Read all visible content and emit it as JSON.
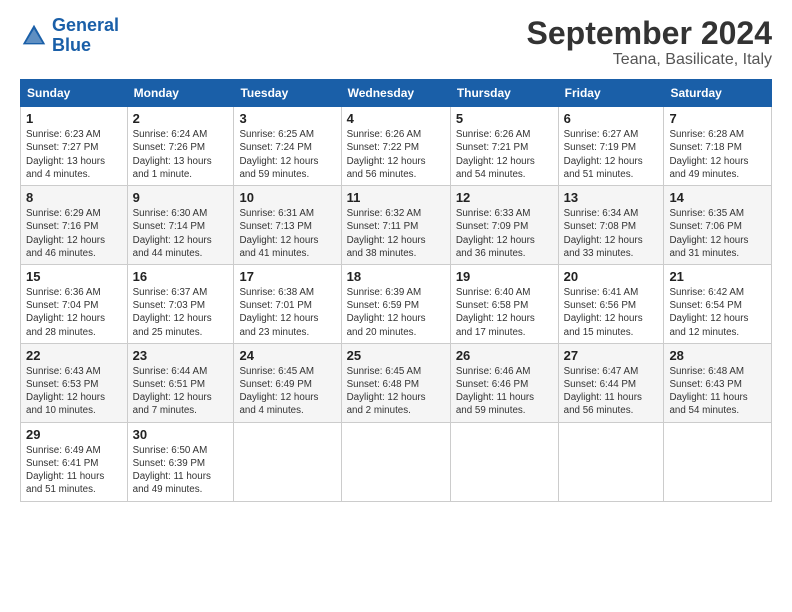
{
  "header": {
    "logo_line1": "General",
    "logo_line2": "Blue",
    "title": "September 2024",
    "subtitle": "Teana, Basilicate, Italy"
  },
  "days_of_week": [
    "Sunday",
    "Monday",
    "Tuesday",
    "Wednesday",
    "Thursday",
    "Friday",
    "Saturday"
  ],
  "weeks": [
    [
      {
        "num": "1",
        "text": "Sunrise: 6:23 AM\nSunset: 7:27 PM\nDaylight: 13 hours\nand 4 minutes."
      },
      {
        "num": "2",
        "text": "Sunrise: 6:24 AM\nSunset: 7:26 PM\nDaylight: 13 hours\nand 1 minute."
      },
      {
        "num": "3",
        "text": "Sunrise: 6:25 AM\nSunset: 7:24 PM\nDaylight: 12 hours\nand 59 minutes."
      },
      {
        "num": "4",
        "text": "Sunrise: 6:26 AM\nSunset: 7:22 PM\nDaylight: 12 hours\nand 56 minutes."
      },
      {
        "num": "5",
        "text": "Sunrise: 6:26 AM\nSunset: 7:21 PM\nDaylight: 12 hours\nand 54 minutes."
      },
      {
        "num": "6",
        "text": "Sunrise: 6:27 AM\nSunset: 7:19 PM\nDaylight: 12 hours\nand 51 minutes."
      },
      {
        "num": "7",
        "text": "Sunrise: 6:28 AM\nSunset: 7:18 PM\nDaylight: 12 hours\nand 49 minutes."
      }
    ],
    [
      {
        "num": "8",
        "text": "Sunrise: 6:29 AM\nSunset: 7:16 PM\nDaylight: 12 hours\nand 46 minutes."
      },
      {
        "num": "9",
        "text": "Sunrise: 6:30 AM\nSunset: 7:14 PM\nDaylight: 12 hours\nand 44 minutes."
      },
      {
        "num": "10",
        "text": "Sunrise: 6:31 AM\nSunset: 7:13 PM\nDaylight: 12 hours\nand 41 minutes."
      },
      {
        "num": "11",
        "text": "Sunrise: 6:32 AM\nSunset: 7:11 PM\nDaylight: 12 hours\nand 38 minutes."
      },
      {
        "num": "12",
        "text": "Sunrise: 6:33 AM\nSunset: 7:09 PM\nDaylight: 12 hours\nand 36 minutes."
      },
      {
        "num": "13",
        "text": "Sunrise: 6:34 AM\nSunset: 7:08 PM\nDaylight: 12 hours\nand 33 minutes."
      },
      {
        "num": "14",
        "text": "Sunrise: 6:35 AM\nSunset: 7:06 PM\nDaylight: 12 hours\nand 31 minutes."
      }
    ],
    [
      {
        "num": "15",
        "text": "Sunrise: 6:36 AM\nSunset: 7:04 PM\nDaylight: 12 hours\nand 28 minutes."
      },
      {
        "num": "16",
        "text": "Sunrise: 6:37 AM\nSunset: 7:03 PM\nDaylight: 12 hours\nand 25 minutes."
      },
      {
        "num": "17",
        "text": "Sunrise: 6:38 AM\nSunset: 7:01 PM\nDaylight: 12 hours\nand 23 minutes."
      },
      {
        "num": "18",
        "text": "Sunrise: 6:39 AM\nSunset: 6:59 PM\nDaylight: 12 hours\nand 20 minutes."
      },
      {
        "num": "19",
        "text": "Sunrise: 6:40 AM\nSunset: 6:58 PM\nDaylight: 12 hours\nand 17 minutes."
      },
      {
        "num": "20",
        "text": "Sunrise: 6:41 AM\nSunset: 6:56 PM\nDaylight: 12 hours\nand 15 minutes."
      },
      {
        "num": "21",
        "text": "Sunrise: 6:42 AM\nSunset: 6:54 PM\nDaylight: 12 hours\nand 12 minutes."
      }
    ],
    [
      {
        "num": "22",
        "text": "Sunrise: 6:43 AM\nSunset: 6:53 PM\nDaylight: 12 hours\nand 10 minutes."
      },
      {
        "num": "23",
        "text": "Sunrise: 6:44 AM\nSunset: 6:51 PM\nDaylight: 12 hours\nand 7 minutes."
      },
      {
        "num": "24",
        "text": "Sunrise: 6:45 AM\nSunset: 6:49 PM\nDaylight: 12 hours\nand 4 minutes."
      },
      {
        "num": "25",
        "text": "Sunrise: 6:45 AM\nSunset: 6:48 PM\nDaylight: 12 hours\nand 2 minutes."
      },
      {
        "num": "26",
        "text": "Sunrise: 6:46 AM\nSunset: 6:46 PM\nDaylight: 11 hours\nand 59 minutes."
      },
      {
        "num": "27",
        "text": "Sunrise: 6:47 AM\nSunset: 6:44 PM\nDaylight: 11 hours\nand 56 minutes."
      },
      {
        "num": "28",
        "text": "Sunrise: 6:48 AM\nSunset: 6:43 PM\nDaylight: 11 hours\nand 54 minutes."
      }
    ],
    [
      {
        "num": "29",
        "text": "Sunrise: 6:49 AM\nSunset: 6:41 PM\nDaylight: 11 hours\nand 51 minutes."
      },
      {
        "num": "30",
        "text": "Sunrise: 6:50 AM\nSunset: 6:39 PM\nDaylight: 11 hours\nand 49 minutes."
      },
      null,
      null,
      null,
      null,
      null
    ]
  ]
}
